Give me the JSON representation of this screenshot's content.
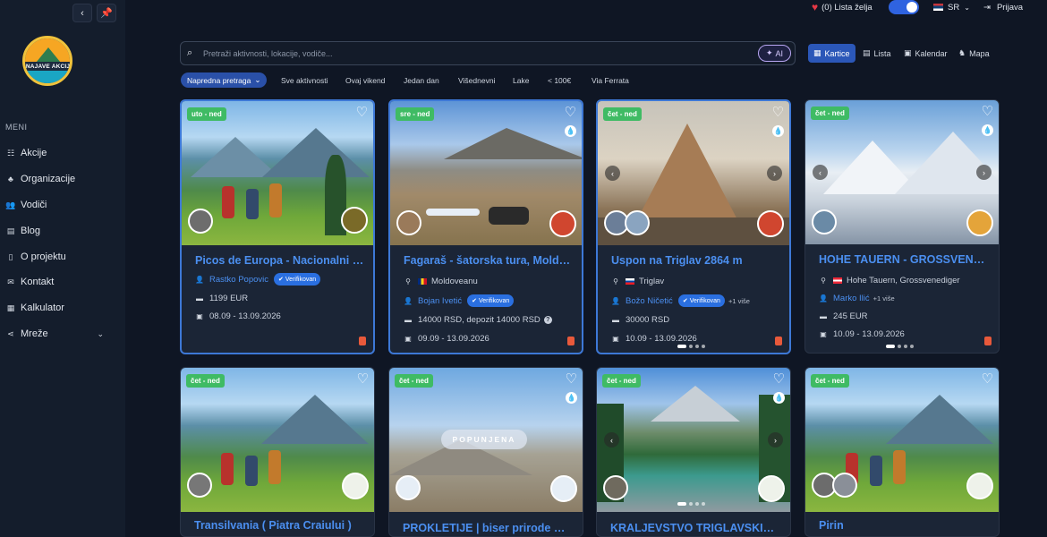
{
  "topbar": {
    "wishlist": "(0) Lista želja",
    "lang": "SR",
    "login": "Prijava"
  },
  "brand": {
    "logo_text": "NAJAVE AKCIJA"
  },
  "sidebar": {
    "title": "MENI",
    "items": [
      {
        "label": "Akcije",
        "icon": "list-icon"
      },
      {
        "label": "Organizacije",
        "icon": "sitemap-icon"
      },
      {
        "label": "Vodiči",
        "icon": "users-icon"
      },
      {
        "label": "Blog",
        "icon": "blog-icon"
      },
      {
        "label": "O projektu",
        "icon": "file-icon"
      },
      {
        "label": "Kontakt",
        "icon": "mail-icon"
      },
      {
        "label": "Kalkulator",
        "icon": "calculator-icon"
      },
      {
        "label": "Mreže",
        "icon": "share-icon"
      }
    ]
  },
  "search": {
    "placeholder": "Pretraži aktivnosti, lokacije, vodiče...",
    "ai_label": "AI"
  },
  "views": [
    {
      "label": "Kartice",
      "active": true
    },
    {
      "label": "Lista"
    },
    {
      "label": "Kalendar"
    },
    {
      "label": "Mapa"
    }
  ],
  "filters": [
    "Napredna pretraga",
    "Sve aktivnosti",
    "Ovaj vikend",
    "Jedan dan",
    "Višednevni",
    "Lake",
    "< 100€",
    "Via Ferrata"
  ],
  "cards": [
    {
      "badge": "uto - ned",
      "title": "Picos de Europa - Nacionalni park",
      "guide": "Rastko Popovic",
      "verified": "Verifikovan",
      "price": "1199 EUR",
      "dates": "08.09 - 13.09.2026"
    },
    {
      "badge": "sre - ned",
      "title": "Fagaraš - šatorska tura, Moldoveanu",
      "location": "Moldoveanu",
      "guide": "Bojan Ivetić",
      "verified": "Verifikovan",
      "price": "14000 RSD, depozit 14000 RSD",
      "dates": "09.09 - 13.09.2026"
    },
    {
      "badge": "čet - ned",
      "title": "Uspon na Triglav 2864 m",
      "location": "Triglav",
      "guide": "Božo Ničetić",
      "verified": "Verifikovan",
      "more": "+1 više",
      "price": "30000 RSD",
      "dates": "10.09 - 13.09.2026"
    },
    {
      "badge": "čet - ned",
      "title": "HOHE TAUERN - GROSSVENEDIGER",
      "location": "Hohe Tauern, Grossvenediger",
      "guide": "Marko Ilić",
      "more": "+1 više",
      "price": "245 EUR",
      "dates": "10.09 - 13.09.2026"
    },
    {
      "badge": "čet - ned",
      "title": "Transilvania ( Piatra Craiului )"
    },
    {
      "badge": "čet - ned",
      "title": "PROKLETIJE | biser prirode Balkana",
      "status": "POPUNJENA"
    },
    {
      "badge": "čet - ned",
      "title": "KRALJEVSTVO TRIGLAVSKIH JEZERA"
    },
    {
      "badge": "čet - ned",
      "title": "Pirin"
    }
  ]
}
